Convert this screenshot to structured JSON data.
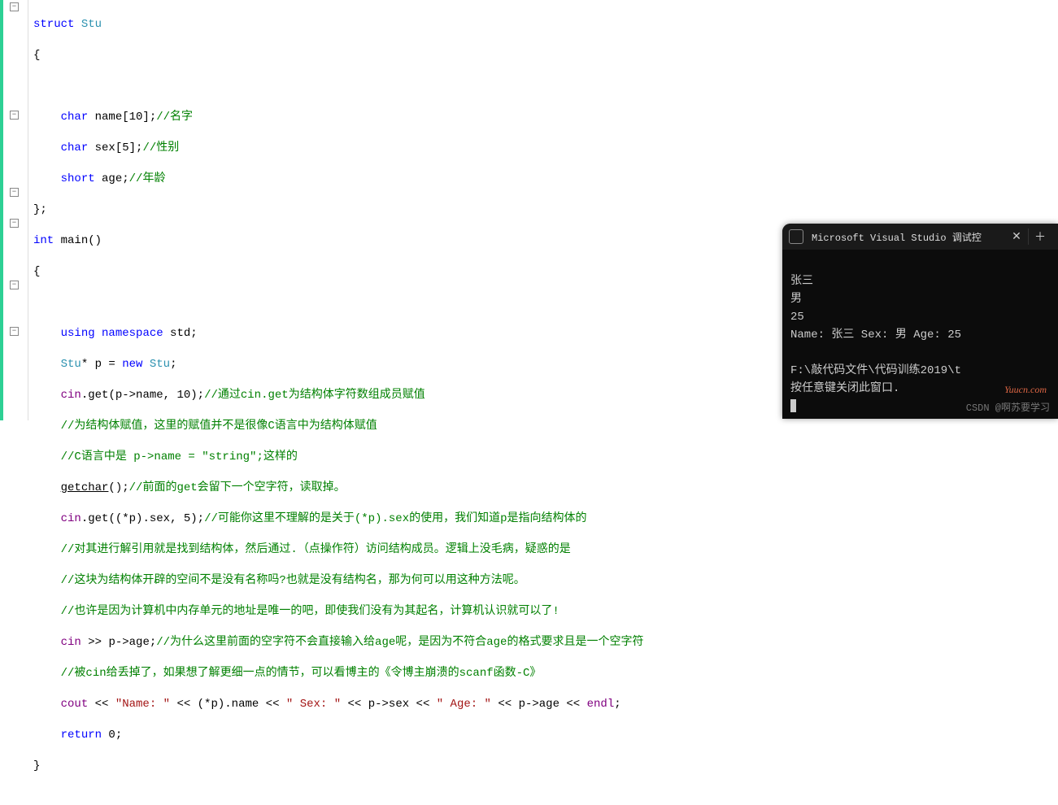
{
  "code": {
    "l1": {
      "kw": "struct",
      "cls": "Stu"
    },
    "l2": "{",
    "l3": {
      "type": "char",
      "decl": " name[10];",
      "cmt": "//名字"
    },
    "l4": {
      "type": "char",
      "decl": " sex[5];",
      "cmt": "//性别"
    },
    "l5": {
      "type": "short",
      "decl": " age;",
      "cmt": "//年龄"
    },
    "l6": "};",
    "l7": {
      "type": "int",
      "fn": " main()"
    },
    "l8": "{",
    "l9": {
      "kw1": "using",
      "kw2": "namespace",
      "ns": " std;"
    },
    "l10": {
      "cls": "Stu",
      "rest": "* p = ",
      "kw": "new",
      "cls2": " Stu",
      ";": ";"
    },
    "l11": {
      "obj": "cin",
      "dot": ".",
      "m": "get",
      "args": "(p->name, 10);",
      "cmt": "//通过cin.get为结构体字符数组成员赋值"
    },
    "l12": "//为结构体赋值，这里的赋值并不是很像C语言中为结构体赋值",
    "l13": "//C语言中是 p->name = \"string\";这样的",
    "l14": {
      "fn": "getchar",
      "rest": "();",
      "cmt": "//前面的get会留下一个空字符，读取掉。"
    },
    "l15": {
      "obj": "cin",
      "dot": ".",
      "m": "get",
      "args": "((*p).sex, 5);",
      "cmt": "//可能你这里不理解的是关于(*p).sex的使用，我们知道p是指向结构体的"
    },
    "l16": "//对其进行解引用就是找到结构体，然后通过.（点操作符）访问结构成员。逻辑上没毛病，疑惑的是",
    "l17": "//这块为结构体开辟的空间不是没有名称吗?也就是没有结构名，那为何可以用这种方法呢。",
    "l18": "//也许是因为计算机中内存单元的地址是唯一的吧，即使我们没有为其起名，计算机认识就可以了!",
    "l19": {
      "obj": "cin",
      "op": " >> ",
      "rest": "p->age;",
      "cmt": "//为什么这里前面的空字符不会直接输入给age呢，是因为不符合age的格式要求且是一个空字符"
    },
    "l20": "//被cin给丢掉了，如果想了解更细一点的情节，可以看博主的《令博主崩溃的scanf函数-C》",
    "l21": {
      "obj": "cout",
      "op1": " << ",
      "s1": "\"Name: \"",
      "op2": " << ",
      "e1": "(*p).name",
      "op3": " << ",
      "s2": "\" Sex: \"",
      "op4": " << ",
      "e2": "p->sex",
      "op5": " << ",
      "s3": "\" Age: \"",
      "op6": " << ",
      "e3": "p->age",
      "op7": " << ",
      "endl": "endl",
      ";": ";"
    },
    "l22": {
      "kw": "return",
      "val": " 0;"
    },
    "l23": "}"
  },
  "console": {
    "title": "Microsoft Visual Studio 调试控",
    "out1": "张三",
    "out2": "男",
    "out3": "25",
    "out4": "Name: 张三 Sex: 男 Age: 25",
    "out5": "",
    "out6": "F:\\敲代码文件\\代码训练2019\\t",
    "out7": "按任意键关闭此窗口."
  },
  "watermark1": "Yuucn.com",
  "watermark2": "CSDN @啊苏要学习"
}
